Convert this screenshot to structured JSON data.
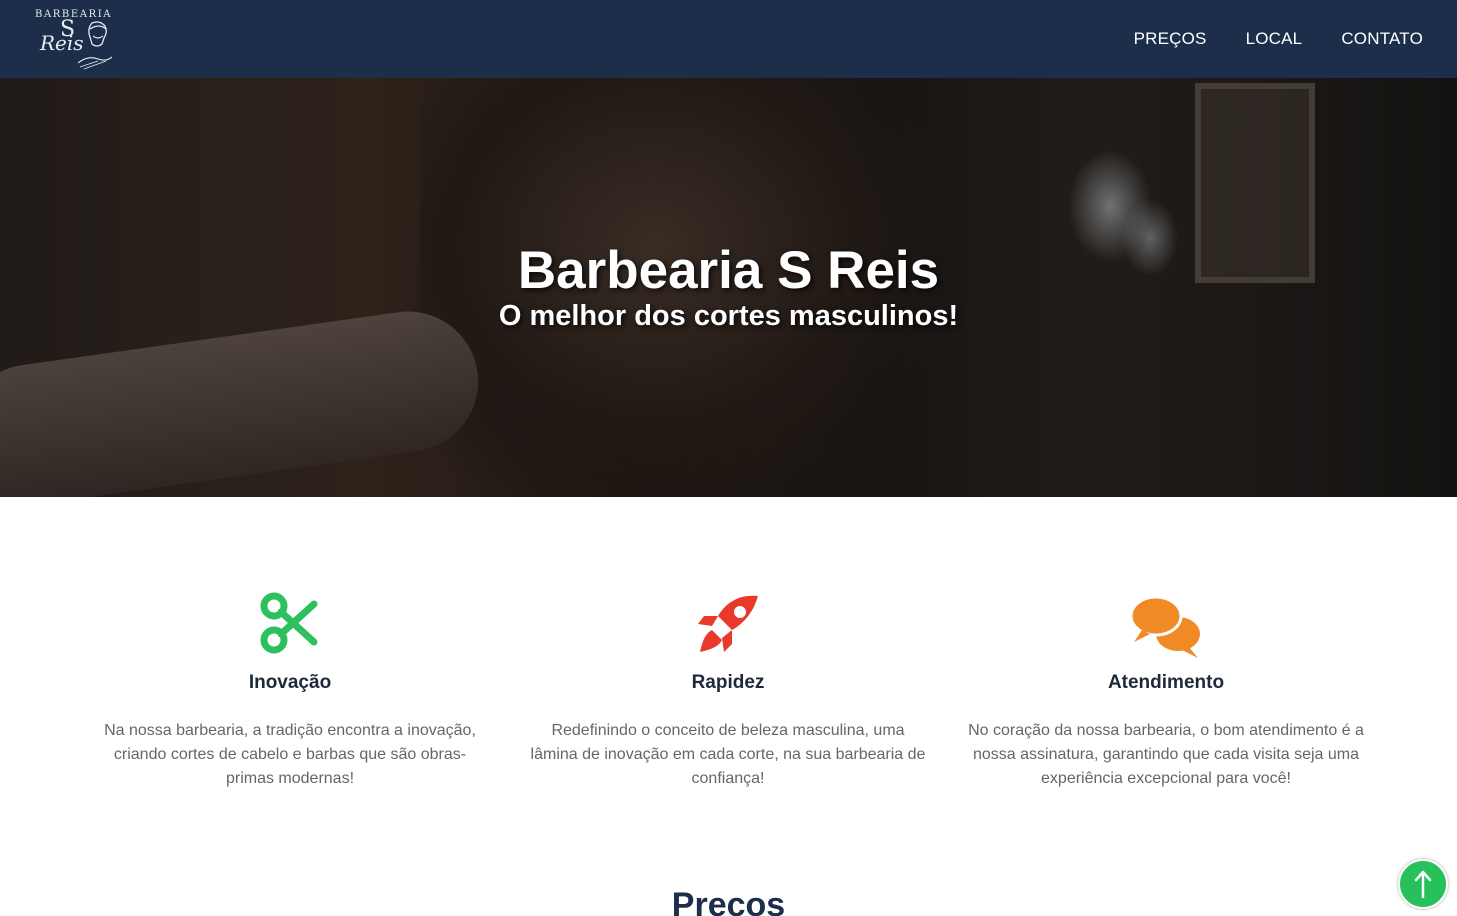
{
  "logo": {
    "top_text": "BARBEARIA",
    "initial": "S",
    "script_text": "Reis"
  },
  "nav": {
    "items": [
      {
        "label": "PREÇOS"
      },
      {
        "label": "LOCAL"
      },
      {
        "label": "CONTATO"
      }
    ]
  },
  "hero": {
    "title": "Barbearia S Reis",
    "subtitle": "O melhor dos cortes masculinos!"
  },
  "features": [
    {
      "icon": "scissors-icon",
      "icon_color": "#2ec05f",
      "title": "Inovação",
      "text": "Na nossa barbearia, a tradição encontra a inovação, criando cortes de cabelo e barbas que são obras-primas modernas!"
    },
    {
      "icon": "rocket-icon",
      "icon_color": "#e8392b",
      "title": "Rapidez",
      "text": "Redefinindo o conceito de beleza masculina, uma lâmina de inovação em cada corte, na sua barbearia de confiança!"
    },
    {
      "icon": "chat-bubbles-icon",
      "icon_color": "#f08a25",
      "title": "Atendimento",
      "text": "No coração da nossa barbearia, o bom atendimento é a nossa assinatura, garantindo que cada visita seja uma experiência excepcional para você!"
    }
  ],
  "section_heading": "Preços",
  "scroll_top": {
    "icon": "arrow-up-icon",
    "color": "#27c05a"
  },
  "colors": {
    "navbar": "#1c2e4a",
    "heading": "#1c2e4a",
    "body_text": "#666666"
  }
}
